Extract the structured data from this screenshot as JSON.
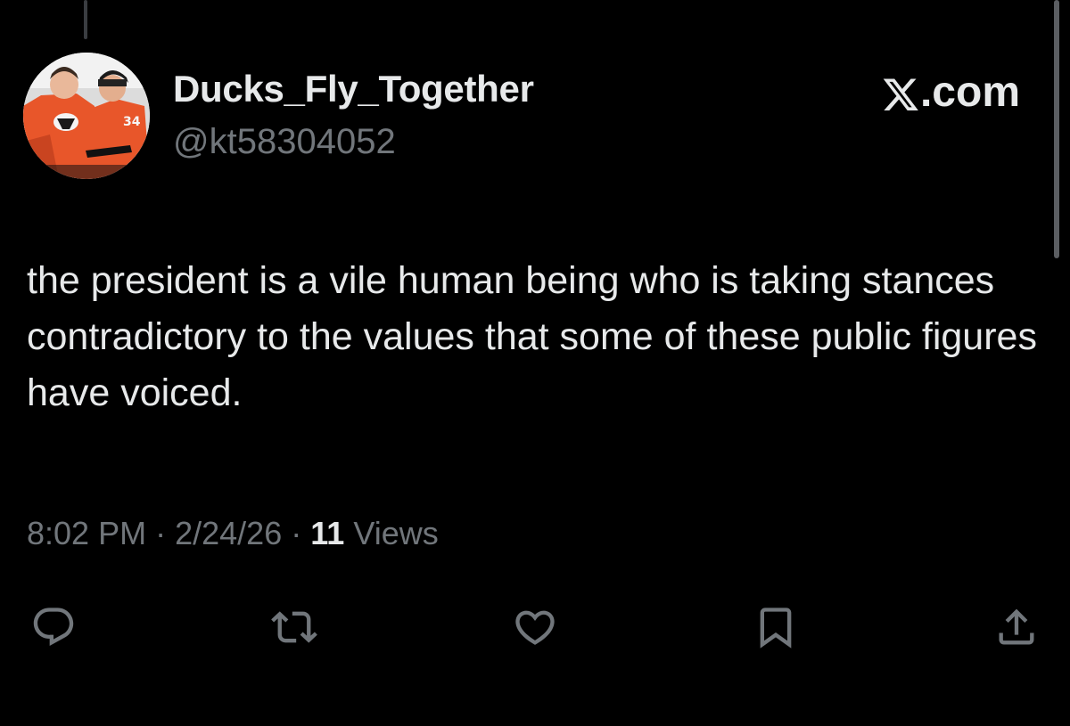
{
  "tweet": {
    "author": {
      "display_name": "Ducks_Fly_Together",
      "handle": "@kt58304052",
      "avatar": "hockey-players-avatar"
    },
    "brand": {
      "label": ".com",
      "icon": "x-logo-icon"
    },
    "text": "the president is a vile human being who is taking stances contradictory to the values that some of these public figures have voiced.",
    "meta": {
      "time": "8:02 PM",
      "separator": "·",
      "date": "2/24/26",
      "views_count": "11",
      "views_label": "Views"
    },
    "actions": [
      {
        "name": "reply",
        "icon": "reply-icon"
      },
      {
        "name": "repost",
        "icon": "repost-icon"
      },
      {
        "name": "like",
        "icon": "heart-icon"
      },
      {
        "name": "bookmark",
        "icon": "bookmark-icon"
      },
      {
        "name": "share",
        "icon": "share-icon"
      }
    ]
  },
  "colors": {
    "background": "#000000",
    "primary_text": "#e7e9ea",
    "secondary_text": "#71767b",
    "avatar_jersey": "#e8562a"
  }
}
